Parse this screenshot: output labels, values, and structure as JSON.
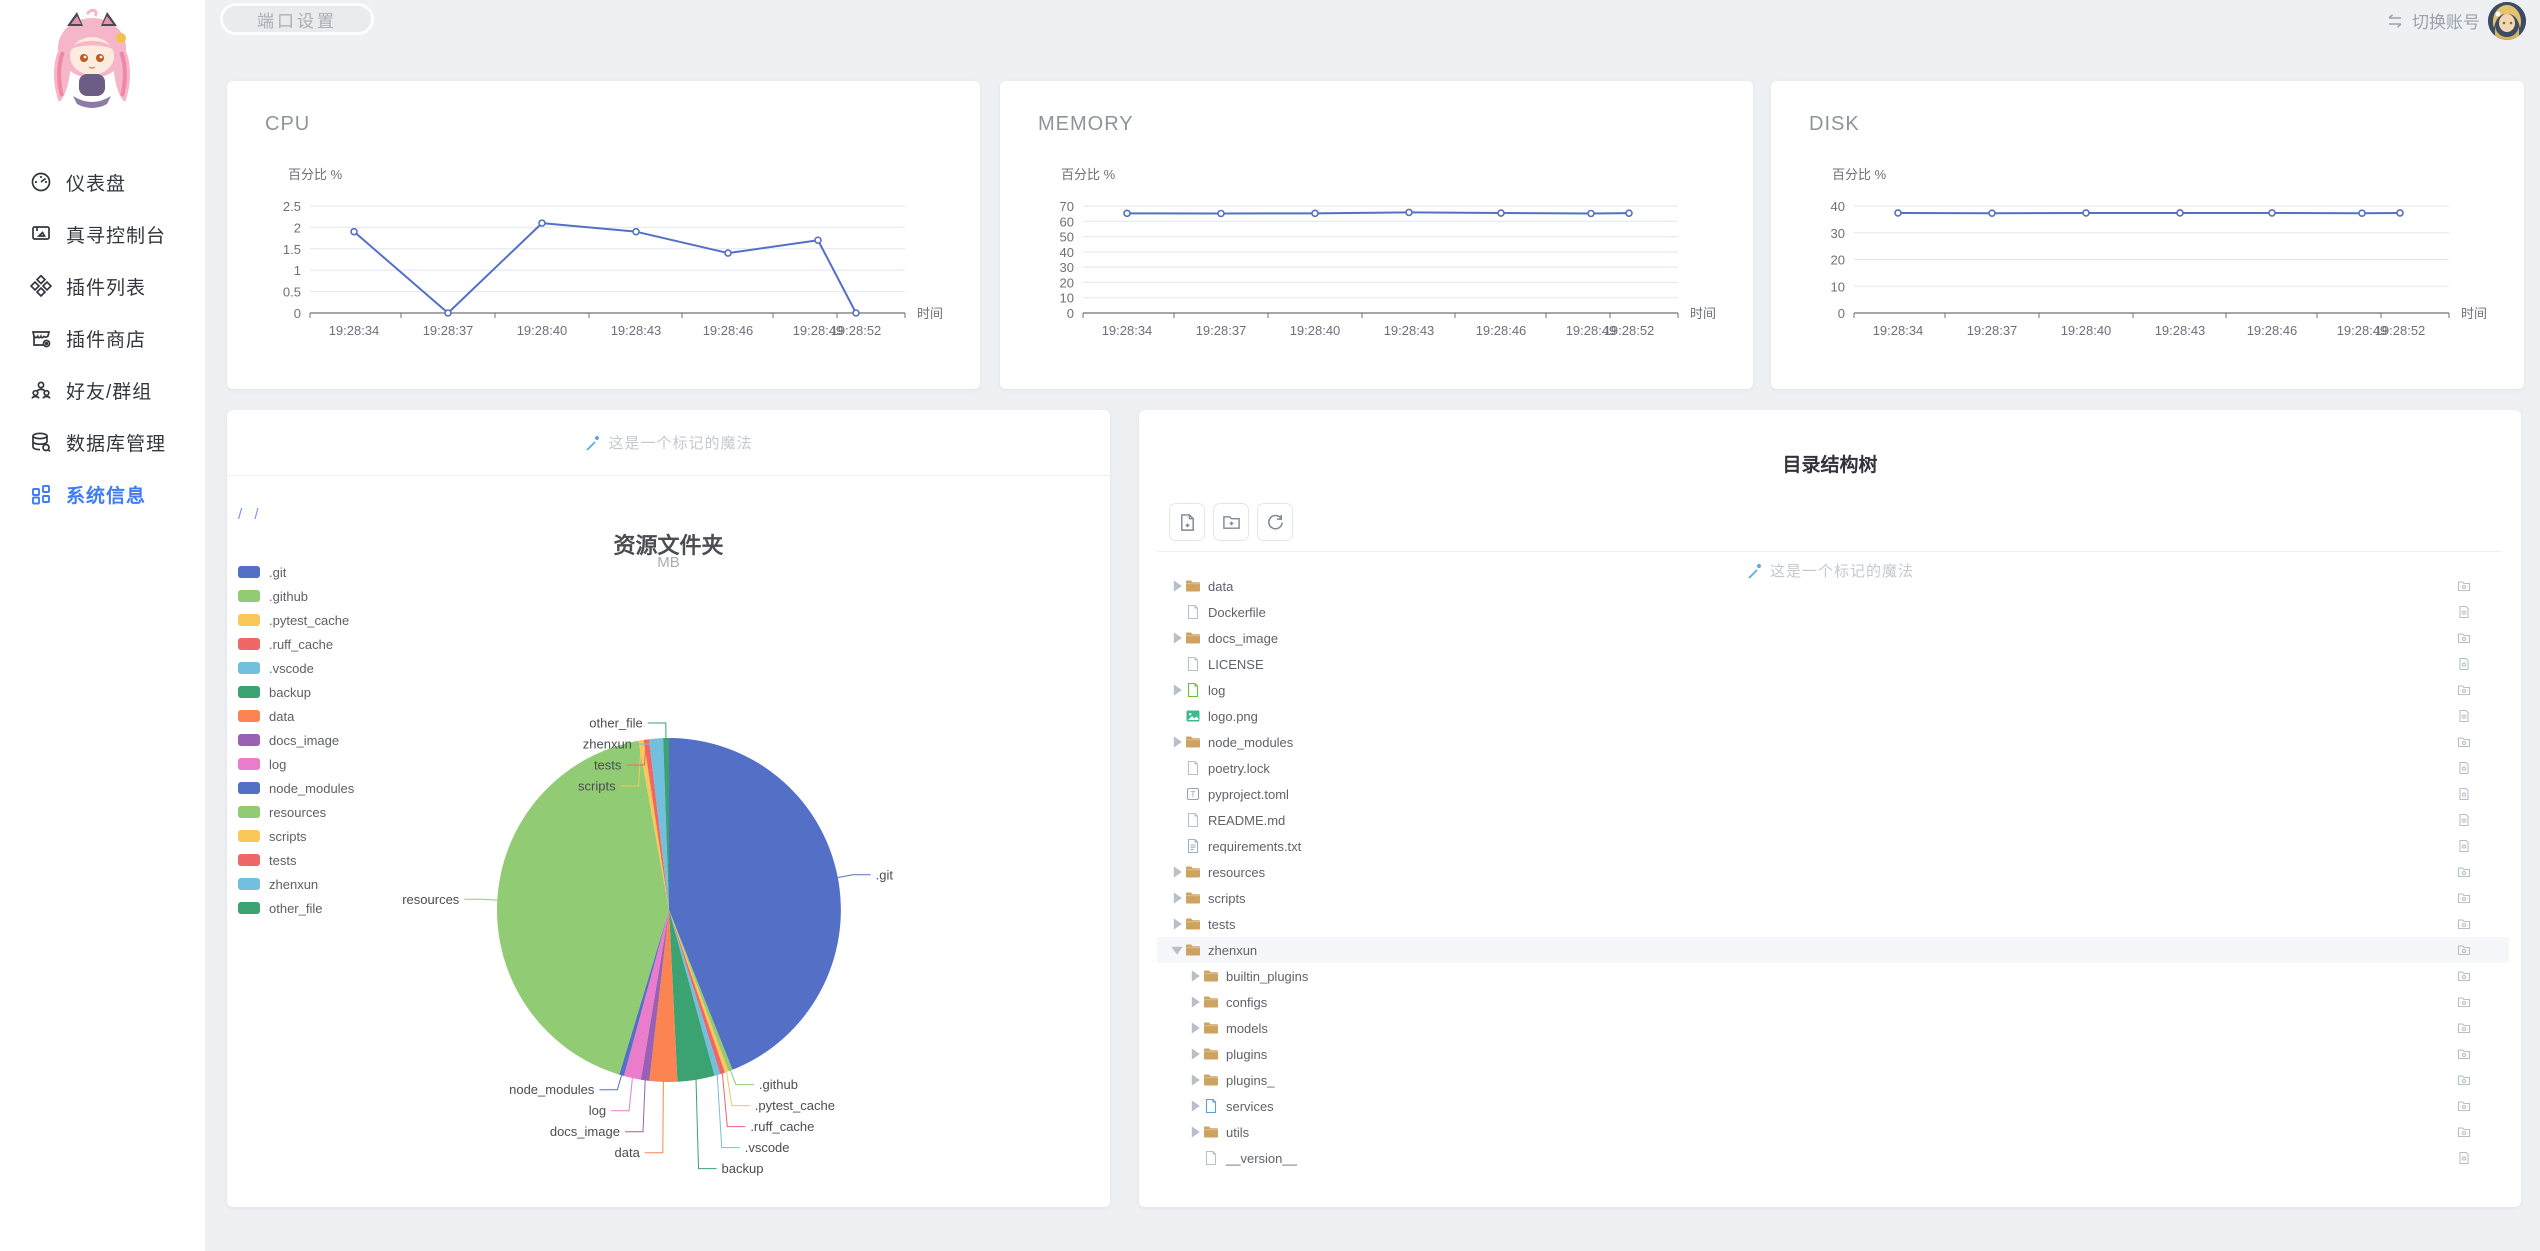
{
  "topbar": {
    "port_button": "端口设置",
    "switch_account": "切换账号"
  },
  "sidebar": {
    "items": [
      {
        "icon": "gauge-icon",
        "label": "仪表盘",
        "active": false
      },
      {
        "icon": "console-icon",
        "label": "真寻控制台",
        "active": false
      },
      {
        "icon": "plugins-icon",
        "label": "插件列表",
        "active": false
      },
      {
        "icon": "store-icon",
        "label": "插件商店",
        "active": false
      },
      {
        "icon": "friends-icon",
        "label": "好友/群组",
        "active": false
      },
      {
        "icon": "database-icon",
        "label": "数据库管理",
        "active": false
      },
      {
        "icon": "grid-icon",
        "label": "系统信息",
        "active": true
      }
    ]
  },
  "colors": {
    "accent": "#3f7cf7",
    "line": "#5470c6",
    "axis": "#6E7079",
    "grid": "#E0E6F1",
    "palette": [
      "#5470c6",
      "#91cc75",
      "#fac858",
      "#ee6666",
      "#73c0de",
      "#3ba272",
      "#fc8452",
      "#9a60b4",
      "#ea7ccc"
    ]
  },
  "chart_data": [
    {
      "id": "cpu",
      "type": "line",
      "title": "CPU",
      "ylabel": "百分比 %",
      "xlabel": "时间",
      "ylim": [
        0,
        2.5
      ],
      "y_ticks": [
        0,
        0.5,
        1,
        1.5,
        2,
        2.5
      ],
      "x": [
        "19:28:34",
        "19:28:37",
        "19:28:40",
        "19:28:43",
        "19:28:46",
        "19:28:49",
        "19:28:52"
      ],
      "values": [
        1.9,
        0,
        2.1,
        1.9,
        1.4,
        1.7,
        0
      ],
      "grid": true,
      "legend_position": "none"
    },
    {
      "id": "memory",
      "type": "line",
      "title": "MEMORY",
      "ylabel": "百分比 %",
      "xlabel": "时间",
      "ylim": [
        0,
        70
      ],
      "y_ticks": [
        0,
        10,
        20,
        30,
        40,
        50,
        60,
        70
      ],
      "x": [
        "19:28:34",
        "19:28:37",
        "19:28:40",
        "19:28:43",
        "19:28:46",
        "19:28:49",
        "19:28:52"
      ],
      "values": [
        65.2,
        65.1,
        65.2,
        65.8,
        65.4,
        65.1,
        65.3
      ],
      "grid": true,
      "legend_position": "none"
    },
    {
      "id": "disk",
      "type": "line",
      "title": "DISK",
      "ylabel": "百分比 %",
      "xlabel": "时间",
      "ylim": [
        0,
        40
      ],
      "y_ticks": [
        0,
        10,
        20,
        30,
        40
      ],
      "x": [
        "19:28:34",
        "19:28:37",
        "19:28:40",
        "19:28:43",
        "19:28:46",
        "19:28:49",
        "19:28:52"
      ],
      "values": [
        37.4,
        37.3,
        37.4,
        37.4,
        37.4,
        37.3,
        37.4
      ],
      "grid": true,
      "legend_position": "none"
    },
    {
      "id": "folders",
      "type": "pie",
      "title": "资源文件夹",
      "subtitle": "MB",
      "unit": "MB",
      "legend_position": "left",
      "slices": [
        {
          "name": ".git",
          "value": 44.0
        },
        {
          "name": ".github",
          "value": 0.4
        },
        {
          "name": ".pytest_cache",
          "value": 0.35
        },
        {
          "name": ".ruff_cache",
          "value": 0.45
        },
        {
          "name": ".vscode",
          "value": 0.55
        },
        {
          "name": "backup",
          "value": 3.5
        },
        {
          "name": "data",
          "value": 2.6
        },
        {
          "name": "docs_image",
          "value": 0.8
        },
        {
          "name": "log",
          "value": 1.6
        },
        {
          "name": "node_modules",
          "value": 0.45
        },
        {
          "name": "resources",
          "value": 42.5
        },
        {
          "name": "scripts",
          "value": 0.5
        },
        {
          "name": "tests",
          "value": 0.5
        },
        {
          "name": "zhenxun",
          "value": 1.3
        },
        {
          "name": "other_file",
          "value": 0.55
        }
      ]
    }
  ],
  "pie_card": {
    "watermark": "这是一个标记的魔法",
    "breadcrumb": "/ /"
  },
  "tree_card": {
    "title": "目录结构树",
    "watermark": "这是一个标记的魔法",
    "toolbar": [
      {
        "icon": "file-plus-icon",
        "name": "new-file-button"
      },
      {
        "icon": "folder-plus-icon",
        "name": "new-folder-button"
      },
      {
        "icon": "refresh-icon",
        "name": "refresh-button"
      }
    ],
    "rows": [
      {
        "label": "data",
        "kind": "folder",
        "level": 0
      },
      {
        "label": "Dockerfile",
        "kind": "file",
        "level": 0
      },
      {
        "label": "docs_image",
        "kind": "folder",
        "level": 0
      },
      {
        "label": "LICENSE",
        "kind": "file",
        "level": 0
      },
      {
        "label": "log",
        "kind": "folder-green",
        "level": 0
      },
      {
        "label": "logo.png",
        "kind": "file-image",
        "level": 0
      },
      {
        "label": "node_modules",
        "kind": "folder",
        "level": 0
      },
      {
        "label": "poetry.lock",
        "kind": "file",
        "level": 0
      },
      {
        "label": "pyproject.toml",
        "kind": "file-toml",
        "level": 0
      },
      {
        "label": "README.md",
        "kind": "file",
        "level": 0
      },
      {
        "label": "requirements.txt",
        "kind": "file-text",
        "level": 0
      },
      {
        "label": "resources",
        "kind": "folder",
        "level": 0
      },
      {
        "label": "scripts",
        "kind": "folder",
        "level": 0
      },
      {
        "label": "tests",
        "kind": "folder",
        "level": 0
      },
      {
        "label": "zhenxun",
        "kind": "folder",
        "level": 0,
        "expanded": true,
        "highlighted": true
      },
      {
        "label": "builtin_plugins",
        "kind": "folder",
        "level": 1
      },
      {
        "label": "configs",
        "kind": "folder",
        "level": 1
      },
      {
        "label": "models",
        "kind": "folder",
        "level": 1
      },
      {
        "label": "plugins",
        "kind": "folder",
        "level": 1
      },
      {
        "label": "plugins_",
        "kind": "folder",
        "level": 1
      },
      {
        "label": "services",
        "kind": "folder-blue",
        "level": 1
      },
      {
        "label": "utils",
        "kind": "folder",
        "level": 1
      },
      {
        "label": "__version__",
        "kind": "file",
        "level": 1
      }
    ]
  }
}
